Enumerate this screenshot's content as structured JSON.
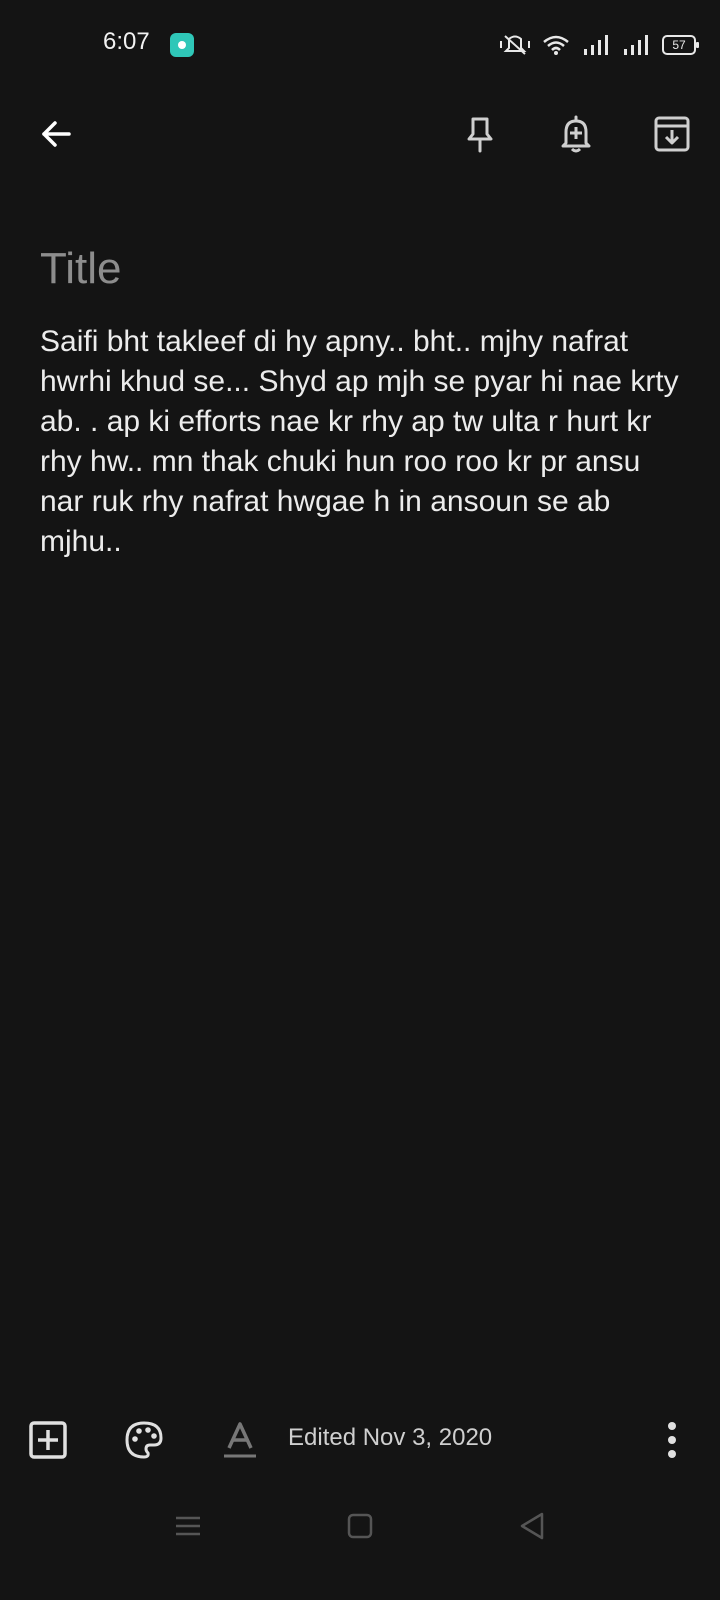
{
  "status_bar": {
    "time": "6:07",
    "battery": "57"
  },
  "toolbar": {
    "back_icon": "arrow-left-icon",
    "pin_icon": "pin-icon",
    "reminder_icon": "bell-plus-icon",
    "archive_icon": "archive-icon"
  },
  "note": {
    "title_placeholder": "Title",
    "body": "Saifi bht takleef di hy apny.. bht.. mjhy nafrat hwrhi khud se... Shyd ap mjh se pyar hi nae krty ab. . ap ki efforts nae kr rhy ap tw ulta r hurt kr rhy hw.. mn thak chuki hun roo roo kr pr ansu nar ruk rhy nafrat hwgae h in ansoun se ab mjhu.."
  },
  "bottom_bar": {
    "edited_label": "Edited Nov 3, 2020"
  },
  "colors": {
    "background": "#141414",
    "text": "#ececec",
    "placeholder": "#8d8d8d",
    "accent_badge": "#2fc7b8"
  }
}
